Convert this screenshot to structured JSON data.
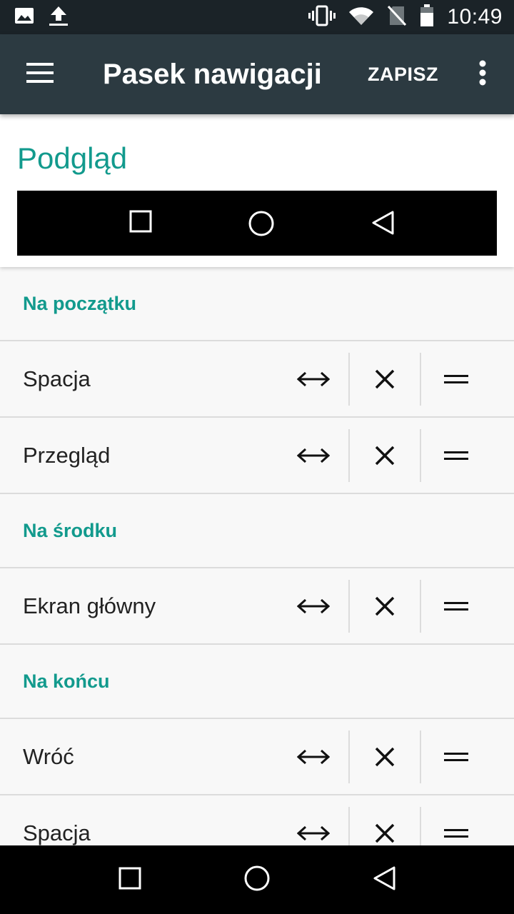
{
  "status_bar": {
    "time": "10:49",
    "icons_left": [
      "image-notification-icon",
      "upload-icon"
    ],
    "icons_right": [
      "vibrate-icon",
      "wifi-icon",
      "no-sim-icon",
      "battery-icon"
    ]
  },
  "toolbar": {
    "title": "Pasek nawigacji",
    "save_label": "ZAPISZ",
    "background": "#2c3a41"
  },
  "preview": {
    "title": "Podgląd",
    "buttons": [
      "recents-icon",
      "home-icon",
      "back-icon"
    ]
  },
  "accent_color": "#129a8d",
  "sections": [
    {
      "title": "Na początku",
      "items": [
        {
          "label": "Spacja"
        },
        {
          "label": "Przegląd"
        }
      ]
    },
    {
      "title": "Na środku",
      "items": [
        {
          "label": "Ekran główny"
        }
      ]
    },
    {
      "title": "Na końcu",
      "items": [
        {
          "label": "Wróć"
        },
        {
          "label": "Spacja"
        }
      ]
    }
  ],
  "row_actions": [
    "resize-width-icon",
    "remove-icon",
    "drag-handle-icon"
  ],
  "system_nav": [
    "recents-icon",
    "home-icon",
    "back-icon"
  ]
}
